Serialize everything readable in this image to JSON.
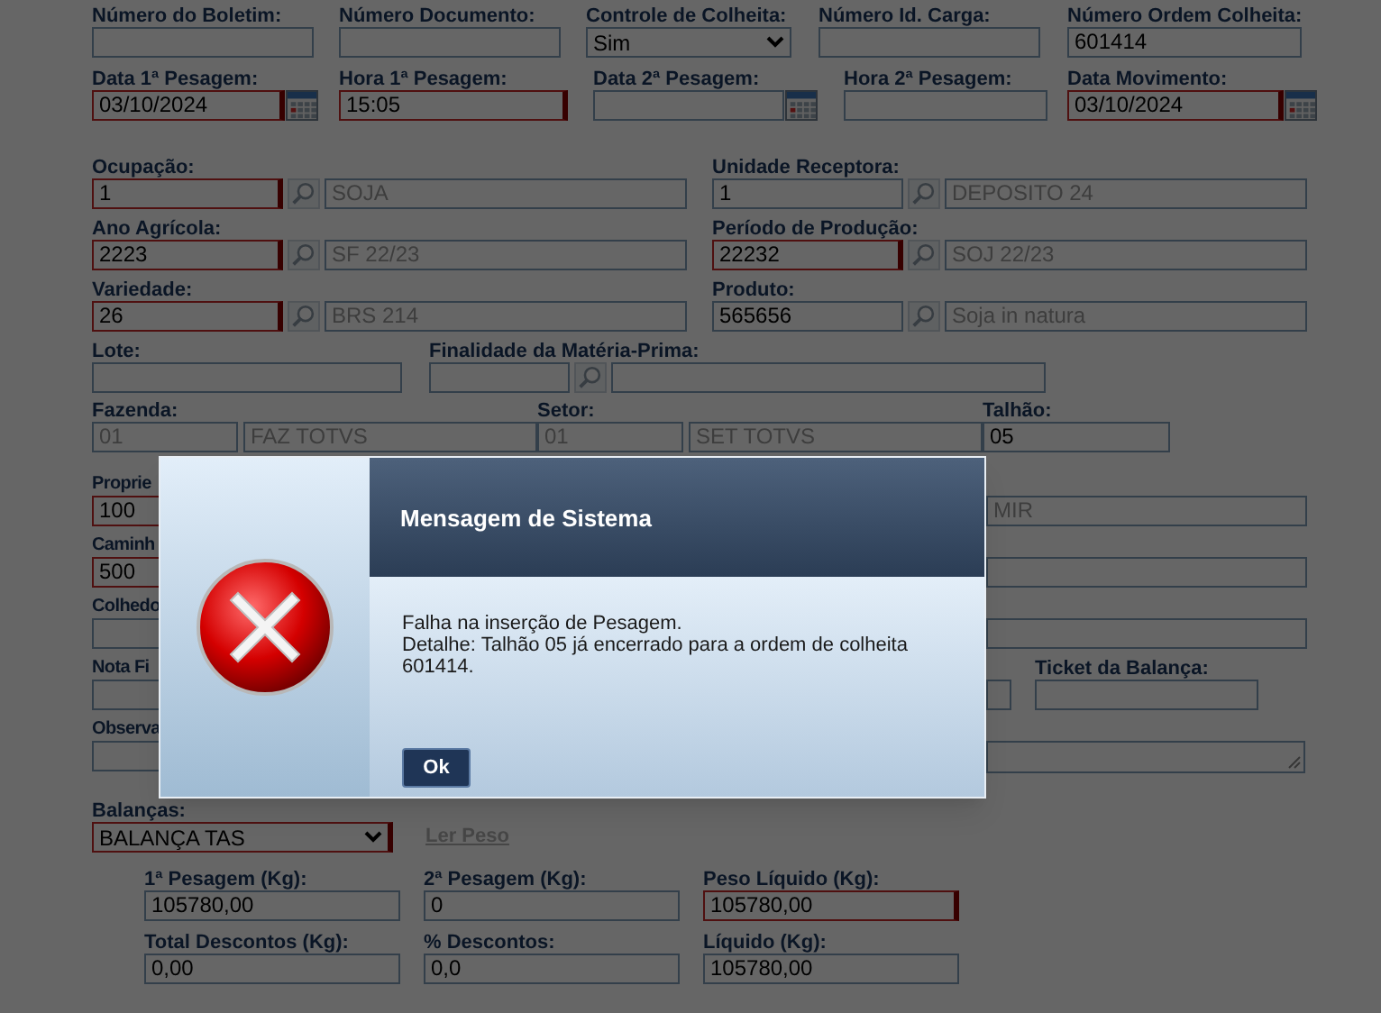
{
  "top_row": [
    {
      "kind": "text",
      "label": "Número do Boletim:"
    },
    {
      "kind": "text",
      "label": "Número Documento:"
    },
    {
      "kind": "select",
      "label": "Controle de Colheita:",
      "value": "Sim"
    },
    {
      "kind": "text",
      "label": "Número Id. Carga:"
    },
    {
      "kind": "text",
      "label": "Número Ordem Colheita:",
      "value": "601414"
    }
  ],
  "date_row": [
    {
      "kind": "date",
      "label": "Data 1ª Pesagem:",
      "value": "03/10/2024",
      "required": true
    },
    {
      "kind": "text",
      "label": "Hora 1ª Pesagem:",
      "value": "15:05",
      "required": true
    },
    {
      "kind": "date",
      "label": "Data 2ª Pesagem:",
      "required": false
    },
    {
      "kind": "text",
      "label": "Hora 2ª Pesagem:",
      "required": false
    },
    {
      "kind": "date",
      "label": "Data Movimento:",
      "value": "03/10/2024",
      "required": true
    }
  ],
  "lookup_rows": [
    [
      {
        "label": "Ocupação:",
        "code": "1",
        "description": "SOJA",
        "required": true
      },
      {
        "label": "Unidade Receptora:",
        "code": "1",
        "description": "DEPOSITO 24",
        "required": false
      }
    ],
    [
      {
        "label": "Ano Agrícola:",
        "code": "2223",
        "description": "SF 22/23",
        "required": true
      },
      {
        "label": "Período de Produção:",
        "code": "22232",
        "description": "SOJ 22/23",
        "required": true
      }
    ],
    [
      {
        "label": "Variedade:",
        "code": "26",
        "description": "BRS 214",
        "required": true
      },
      {
        "label": "Produto:",
        "code": "565656",
        "description": "Soja in natura",
        "required": false
      }
    ]
  ],
  "lote": {
    "label": "Lote:"
  },
  "finalidade": {
    "label": "Finalidade da Matéria-Prima:"
  },
  "location_row": [
    {
      "kind": "pair",
      "label": "Fazenda:",
      "code": "01",
      "description": "FAZ TOTVS"
    },
    {
      "kind": "pair",
      "label": "Setor:",
      "code": "01",
      "description": "SET TOTVS"
    },
    {
      "kind": "text",
      "label": "Talhão:",
      "value": "05"
    }
  ],
  "covered_rows": [
    {
      "label": "Proprie",
      "value": "100",
      "required": true,
      "right": [
        {
          "kind": "text",
          "value": "MIR"
        }
      ]
    },
    {
      "label": "Caminh",
      "value": "500",
      "required": true,
      "right": [
        {
          "kind": "text"
        }
      ]
    },
    {
      "label": "Colhedo",
      "required": false,
      "right": [
        {
          "kind": "text"
        }
      ]
    },
    {
      "label": "Nota Fi",
      "required": false,
      "right": [
        {
          "kind": "stub"
        },
        {
          "kind": "labeled",
          "label": "Ticket da Balança:"
        }
      ]
    },
    {
      "label": "Observa",
      "required": false,
      "right": [
        {
          "kind": "textarea"
        }
      ]
    }
  ],
  "scale": {
    "label": "Balanças:",
    "value": "BALANÇA TAS",
    "required": true,
    "link": "Ler Peso",
    "link_disabled": true
  },
  "weights": [
    [
      {
        "label": "1ª Pesagem (Kg):",
        "value": "105780,00",
        "required": false
      },
      {
        "label": "2ª Pesagem (Kg):",
        "value": "0",
        "required": false
      },
      {
        "label": "Peso Líquido (Kg):",
        "value": "105780,00",
        "required": true
      }
    ],
    [
      {
        "label": "Total Descontos (Kg):",
        "value": "0,00",
        "required": false
      },
      {
        "label": "% Descontos:",
        "value": "0,0",
        "required": false
      },
      {
        "label": "Líquido (Kg):",
        "value": "105780,00",
        "required": false
      }
    ]
  ],
  "dialog": {
    "title": "Mensagem de Sistema",
    "lines": [
      "Falha na inserção de Pesagem.",
      "Detalhe: Talhão 05 já encerrado para a ordem de colheita 601414."
    ],
    "button": "Ok"
  }
}
